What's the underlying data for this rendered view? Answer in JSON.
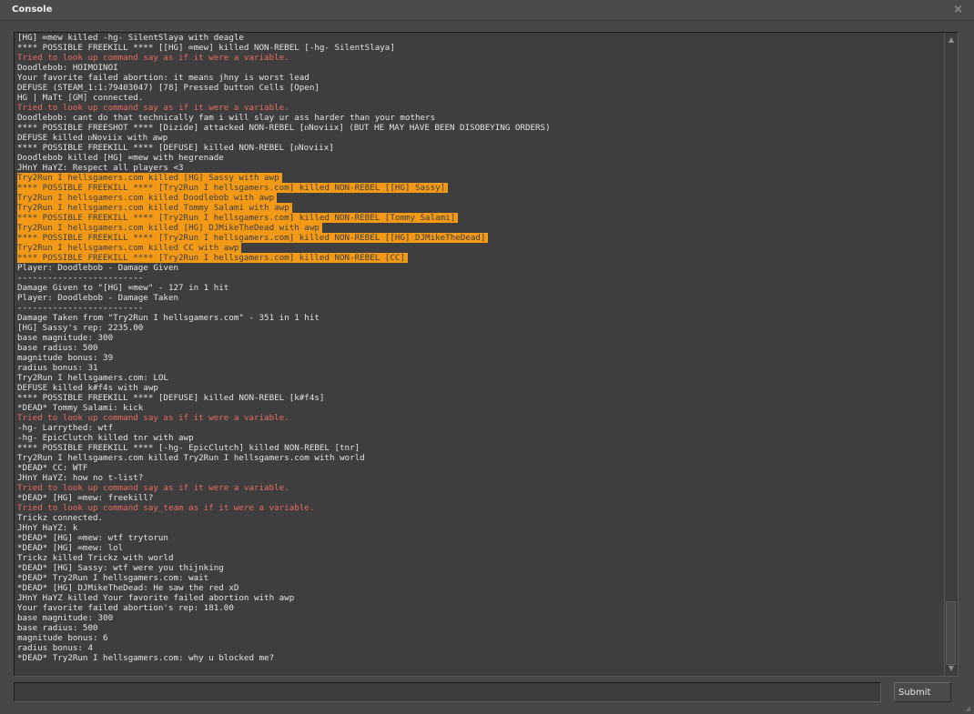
{
  "window": {
    "title": "Console",
    "close_glyph": "×"
  },
  "colors": {
    "background": "#474747",
    "log_bg": "#3e3e3e",
    "text": "#e3e3e3",
    "error": "#e86a62",
    "highlight": "#f29a18"
  },
  "log": [
    {
      "text": "[HG] ∞mew killed -hg- SilentSlaya with deagle",
      "style": "normal"
    },
    {
      "text": "**** POSSIBLE FREEKILL **** [[HG] ∞mew] killed NON-REBEL [-hg- SilentSlaya]",
      "style": "normal"
    },
    {
      "text": "Tried to look up command say as if it were a variable.",
      "style": "error"
    },
    {
      "text": "Doodlebob: HOIMOINOI",
      "style": "normal"
    },
    {
      "text": "Your favorite failed abortion: it means jhny is worst lead",
      "style": "normal"
    },
    {
      "text": "DEFUSE (STEAM_1:1:79403047) [78] Pressed button Cells [Open]",
      "style": "normal"
    },
    {
      "text": "HG | MaTt [GM] connected.",
      "style": "normal"
    },
    {
      "text": "Tried to look up command say as if it were a variable.",
      "style": "error"
    },
    {
      "text": "Doodlebob: cant do that technically fam i will slay ur ass harder than your mothers",
      "style": "normal"
    },
    {
      "text": "**** POSSIBLE FREESHOT **** [Dizide] attacked NON-REBEL [ᴅNoviix] (BUT HE MAY HAVE BEEN DISOBEYING ORDERS)",
      "style": "normal"
    },
    {
      "text": "DEFUSE killed ᴅNoviix with awp",
      "style": "normal"
    },
    {
      "text": "**** POSSIBLE FREEKILL **** [DEFUSE] killed NON-REBEL [ᴅNoviix]",
      "style": "normal"
    },
    {
      "text": "Doodlebob killed [HG] ∞mew with hegrenade",
      "style": "normal"
    },
    {
      "text": "JHnY HaYZ: Respect all players <3",
      "style": "normal"
    },
    {
      "text": "Try2Run I hellsgamers.com killed [HG] Sassy with awp",
      "style": "highlight"
    },
    {
      "text": "**** POSSIBLE FREEKILL **** [Try2Run I hellsgamers.com] killed NON-REBEL [[HG] Sassy]",
      "style": "highlight"
    },
    {
      "text": "Try2Run I hellsgamers.com killed Doodlebob with awp",
      "style": "highlight"
    },
    {
      "text": "Try2Run I hellsgamers.com killed Tommy Salami with awp",
      "style": "highlight"
    },
    {
      "text": "**** POSSIBLE FREEKILL **** [Try2Run I hellsgamers.com] killed NON-REBEL [Tommy Salami]",
      "style": "highlight"
    },
    {
      "text": "Try2Run I hellsgamers.com killed [HG] DJMikeTheDead with awp",
      "style": "highlight"
    },
    {
      "text": "**** POSSIBLE FREEKILL **** [Try2Run I hellsgamers.com] killed NON-REBEL [[HG] DJMikeTheDead]",
      "style": "highlight"
    },
    {
      "text": "Try2Run I hellsgamers.com killed CC with awp",
      "style": "highlight"
    },
    {
      "text": "**** POSSIBLE FREEKILL **** [Try2Run I hellsgamers.com] killed NON-REBEL [CC]",
      "style": "highlight"
    },
    {
      "text": "Player: Doodlebob - Damage Given",
      "style": "normal"
    },
    {
      "text": "-------------------------",
      "style": "normal"
    },
    {
      "text": "Damage Given to \"[HG] ∞mew\" - 127 in 1 hit",
      "style": "normal"
    },
    {
      "text": "Player: Doodlebob - Damage Taken",
      "style": "normal"
    },
    {
      "text": "-------------------------",
      "style": "normal"
    },
    {
      "text": "Damage Taken from \"Try2Run I hellsgamers.com\" - 351 in 1 hit",
      "style": "normal"
    },
    {
      "text": "[HG] Sassy's rep: 2235.00",
      "style": "normal"
    },
    {
      "text": "base magnitude: 300",
      "style": "normal"
    },
    {
      "text": "base radius: 500",
      "style": "normal"
    },
    {
      "text": "magnitude bonus: 39",
      "style": "normal"
    },
    {
      "text": "radius bonus: 31",
      "style": "normal"
    },
    {
      "text": "Try2Run I hellsgamers.com: LOL",
      "style": "normal"
    },
    {
      "text": "DEFUSE killed k#f4s with awp",
      "style": "normal"
    },
    {
      "text": "**** POSSIBLE FREEKILL **** [DEFUSE] killed NON-REBEL [k#f4s]",
      "style": "normal"
    },
    {
      "text": "*DEAD* Tommy Salami: kick",
      "style": "normal"
    },
    {
      "text": "Tried to look up command say as if it were a variable.",
      "style": "error"
    },
    {
      "text": "-hg- Larrythed: wtf",
      "style": "normal"
    },
    {
      "text": "-hg- EpicClutch killed tnr with awp",
      "style": "normal"
    },
    {
      "text": "**** POSSIBLE FREEKILL **** [-hg- EpicClutch] killed NON-REBEL [tnr]",
      "style": "normal"
    },
    {
      "text": "Try2Run I hellsgamers.com killed Try2Run I hellsgamers.com with world",
      "style": "normal"
    },
    {
      "text": "*DEAD* CC: WTF",
      "style": "normal"
    },
    {
      "text": "JHnY HaYZ: how no t-list?",
      "style": "normal"
    },
    {
      "text": "Tried to look up command say as if it were a variable.",
      "style": "error"
    },
    {
      "text": "*DEAD* [HG] ∞mew: freekill?",
      "style": "normal"
    },
    {
      "text": "Tried to look up command say_team as if it were a variable.",
      "style": "error"
    },
    {
      "text": "Trickz connected.",
      "style": "normal"
    },
    {
      "text": "JHnY HaYZ: k",
      "style": "normal"
    },
    {
      "text": "*DEAD* [HG] ∞mew: wtf trytorun",
      "style": "normal"
    },
    {
      "text": "*DEAD* [HG] ∞mew: lol",
      "style": "normal"
    },
    {
      "text": "Trickz killed Trickz with world",
      "style": "normal"
    },
    {
      "text": "*DEAD* [HG] Sassy: wtf were you thijnking",
      "style": "normal"
    },
    {
      "text": "*DEAD* Try2Run I hellsgamers.com: wait",
      "style": "normal"
    },
    {
      "text": "*DEAD* [HG] DJMikeTheDead: He saw the red xD",
      "style": "normal"
    },
    {
      "text": "JHnY HaYZ killed Your favorite failed abortion with awp",
      "style": "normal"
    },
    {
      "text": "Your favorite failed abortion's rep: 181.00",
      "style": "normal"
    },
    {
      "text": "base magnitude: 300",
      "style": "normal"
    },
    {
      "text": "base radius: 500",
      "style": "normal"
    },
    {
      "text": "magnitude bonus: 6",
      "style": "normal"
    },
    {
      "text": "radius bonus: 4",
      "style": "normal"
    },
    {
      "text": "*DEAD* Try2Run I hellsgamers.com: why u blocked me?",
      "style": "normal"
    }
  ],
  "input": {
    "value": "",
    "placeholder": ""
  },
  "submit_label": "Submit",
  "scrollbar": {
    "up_glyph": "▲",
    "down_glyph": "▼",
    "position": 1.0
  },
  "resize_glyph": "◢"
}
